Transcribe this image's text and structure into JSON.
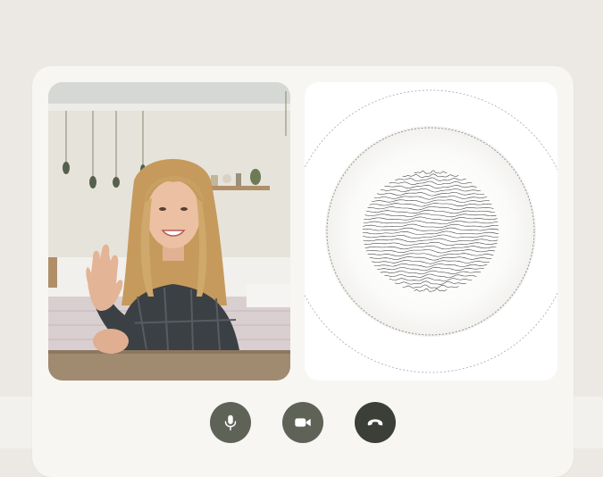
{
  "colors": {
    "page_background": "#ece8e3",
    "card_background": "#f7f6f3",
    "control_button": "#5e6257",
    "end_call_button": "#3c3f38",
    "icon": "#ffffff"
  },
  "tiles": {
    "user_video": {
      "content": "person-waving-in-bedroom"
    },
    "assistant_visual": {
      "content": "audio-orb-visualizer"
    }
  },
  "controls": [
    {
      "icon": "microphone-icon"
    },
    {
      "icon": "video-camera-icon"
    },
    {
      "icon": "end-call-icon"
    }
  ]
}
